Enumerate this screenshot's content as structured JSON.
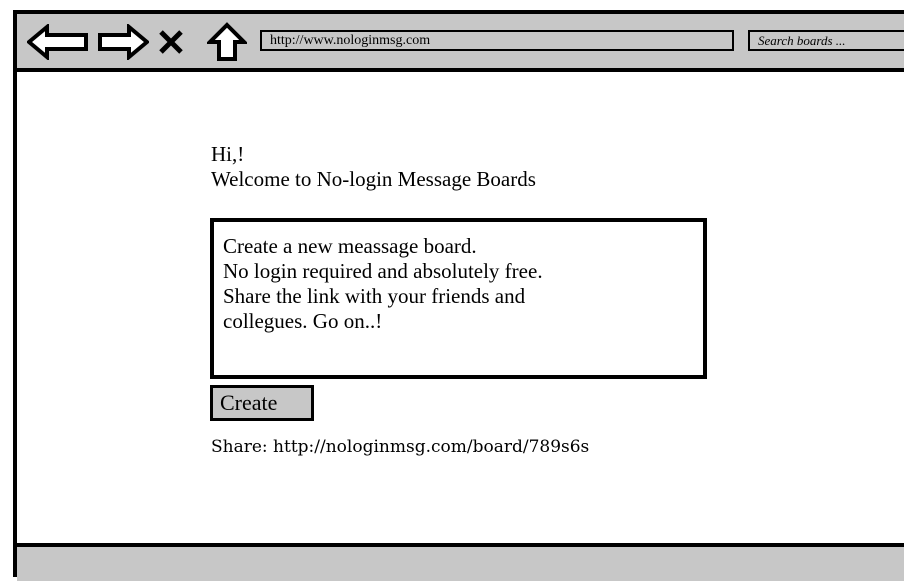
{
  "browser": {
    "url": "http://www.nologinmsg.com",
    "search_placeholder": "Search boards ...",
    "icons": [
      "back-arrow-icon",
      "forward-arrow-icon",
      "close-icon",
      "home-up-icon"
    ]
  },
  "main": {
    "greeting": "Hi,!",
    "welcome": "Welcome to No-login Message Boards",
    "info_lines": [
      "Create a new meassage board.",
      "No login required and absolutely free.",
      "Share the link with your friends and",
      "collegues. Go on..!"
    ],
    "create_label": "Create",
    "share_text": "Share: http://nologinmsg.com/board/789s6s"
  },
  "colors": {
    "chrome_gray": "#c7c7c7",
    "border": "#000000",
    "background": "#ffffff"
  }
}
